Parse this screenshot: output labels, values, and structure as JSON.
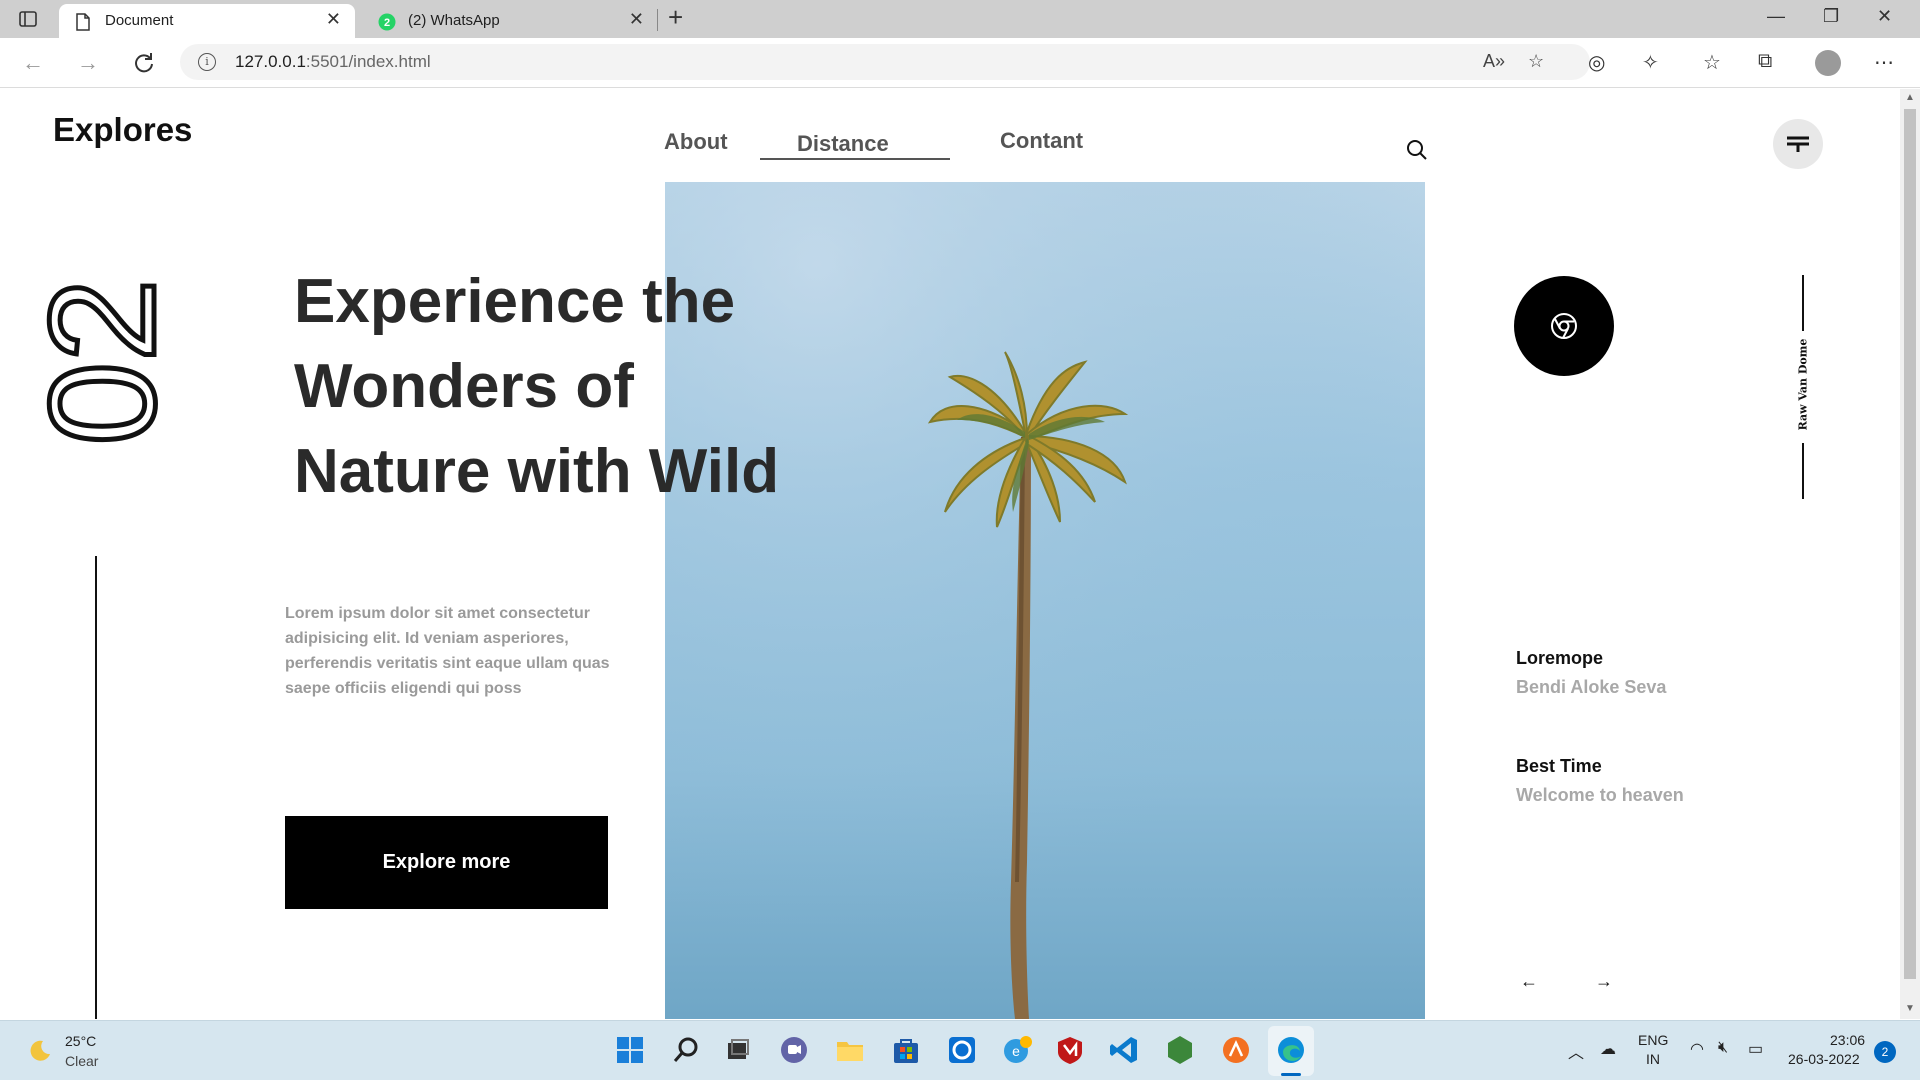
{
  "browser": {
    "tabs": [
      {
        "title": "Document",
        "icon": "page-icon",
        "active": true
      },
      {
        "title": "(2) WhatsApp",
        "icon": "whatsapp-icon",
        "badge": "2",
        "active": false
      }
    ],
    "url_host": "127.0.0.1",
    "url_rest": ":5501/index.html",
    "new_tab_label": "+"
  },
  "site": {
    "logo": "Explores",
    "nav": [
      "About",
      "Distance",
      "Contant"
    ],
    "active_nav": "Distance",
    "slide_number": "02",
    "headline_lines": [
      "Experience the",
      "Wonders of",
      "Nature with Wild"
    ],
    "description": "Lorem ipsum dolor sit amet consectetur adipisicing elit. Id veniam asperiores, perferendis veritatis sint eaque ullam quas saepe officiis eligendi qui poss",
    "cta_label": "Explore more",
    "vertical_text": "Raw Van Dome",
    "side_items": [
      {
        "title": "Loremope",
        "subtitle": "Bendi Aloke Seva"
      },
      {
        "title": "Best Time",
        "subtitle": "Welcome to heaven"
      }
    ],
    "prev_arrow": "←",
    "next_arrow": "→"
  },
  "taskbar": {
    "weather_temp": "25°C",
    "weather_condition": "Clear",
    "language_top": "ENG",
    "language_bottom": "IN",
    "time": "23:06",
    "date": "26-03-2022",
    "notification_count": "2"
  },
  "colors": {
    "accent": "#000000",
    "sky_top": "#b9d4e7",
    "sky_bottom": "#6fa6c6",
    "muted_text": "#9a9a9a"
  }
}
